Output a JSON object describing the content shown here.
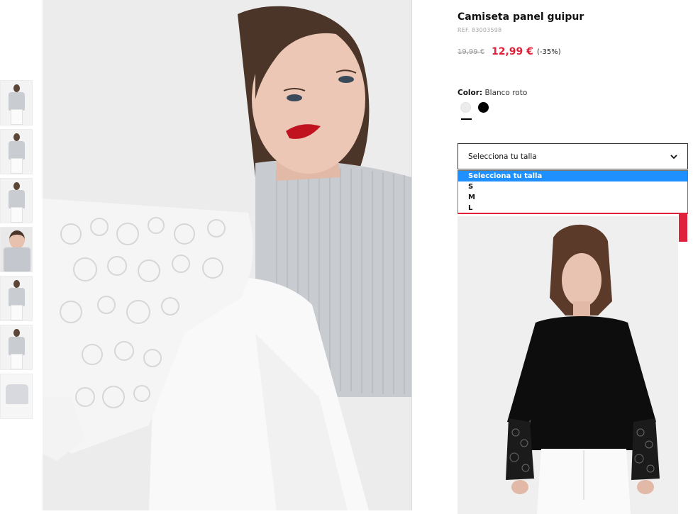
{
  "gallery": {
    "thumbnails": [
      {
        "kind": "model-front"
      },
      {
        "kind": "model-front"
      },
      {
        "kind": "model-back"
      },
      {
        "kind": "model-closeup"
      },
      {
        "kind": "model-front"
      },
      {
        "kind": "detail"
      },
      {
        "kind": "flat-lay"
      }
    ],
    "active_index": 3
  },
  "product": {
    "title": "Camiseta panel guipur",
    "ref": "REF. 83003598",
    "price_old": "19,99 €",
    "price_new": "12,99 €",
    "discount": "(-35%)",
    "color_label": "Color:",
    "color_value": "Blanco roto",
    "colors": [
      {
        "name": "Blanco roto",
        "hex": "#ececea"
      },
      {
        "name": "Negro",
        "hex": "#000000"
      }
    ],
    "selected_color_index": 0
  },
  "size_select": {
    "label": "Selecciona tu talla",
    "options": [
      "Selecciona tu talla",
      "S",
      "M",
      "L"
    ],
    "selected_index": 0
  },
  "colors": {
    "accent_red": "#e0213a",
    "select_highlight": "#1e90ff"
  }
}
